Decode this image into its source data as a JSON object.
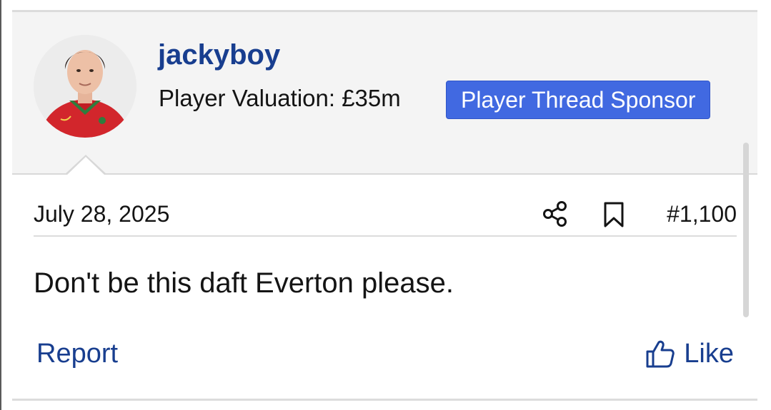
{
  "post": {
    "username": "jackyboy",
    "valuation": "Player Valuation: £35m",
    "badge": "Player Thread Sponsor",
    "date": "July 28, 2025",
    "post_number": "#1,100",
    "message": "Don't be this daft Everton please.",
    "report_label": "Report",
    "like_label": "Like"
  },
  "icons": {
    "share": "share-icon",
    "bookmark": "bookmark-icon",
    "like": "thumbs-up-icon"
  },
  "colors": {
    "link": "#183e8f",
    "badge_bg": "#4169e1",
    "user_block_bg": "#f4f4f4"
  }
}
